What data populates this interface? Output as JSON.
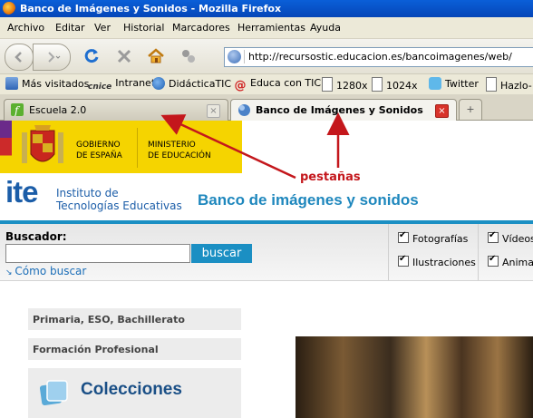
{
  "window": {
    "title": "Banco de Imágenes y Sonidos - Mozilla Firefox"
  },
  "menu": [
    "Archivo",
    "Editar",
    "Ver",
    "Historial",
    "Marcadores",
    "Herramientas",
    "Ayuda"
  ],
  "address": {
    "url": "http://recursostic.educacion.es/bancoimagenes/web/"
  },
  "bookmarks": [
    "Más visitados",
    "Intranet",
    "DidácticaTIC",
    "Educa con TIC",
    "1280x",
    "1024x",
    "Twitter",
    "Hazlo-"
  ],
  "bookmark_icon_texts": {
    "intranet": "cnice",
    "educa": "@"
  },
  "tabs": [
    {
      "label": "Escuela 2.0",
      "active": false
    },
    {
      "label": "Banco de Imágenes y Sonidos",
      "active": true
    }
  ],
  "new_tab_symbol": "+",
  "page": {
    "gov_line1": "GOBIERNO",
    "gov_line2": "DE ESPAÑA",
    "min_line1": "MINISTERIO",
    "min_line2": "DE EDUCACIÓN",
    "ite_logo": "ite",
    "ite_name_line1": "Instituto de",
    "ite_name_line2": "Tecnologías Educativas",
    "banco_title": "Banco de imágenes y sonidos",
    "search_label": "Buscador:",
    "search_value": "",
    "search_button": "buscar",
    "how_search": "Cómo buscar",
    "filters": [
      "Fotografías",
      "Ilustraciones",
      "Vídeos",
      "Animac"
    ],
    "nav": [
      "Primaria, ESO, Bachillerato",
      "Formación Profesional"
    ],
    "collections": "Colecciones"
  },
  "annotation": {
    "label": "pestañas",
    "color": "#c4171c"
  },
  "colors": {
    "accent": "#1b8fc3",
    "gov_yellow": "#f5d400",
    "ite_blue": "#1b5da8"
  }
}
